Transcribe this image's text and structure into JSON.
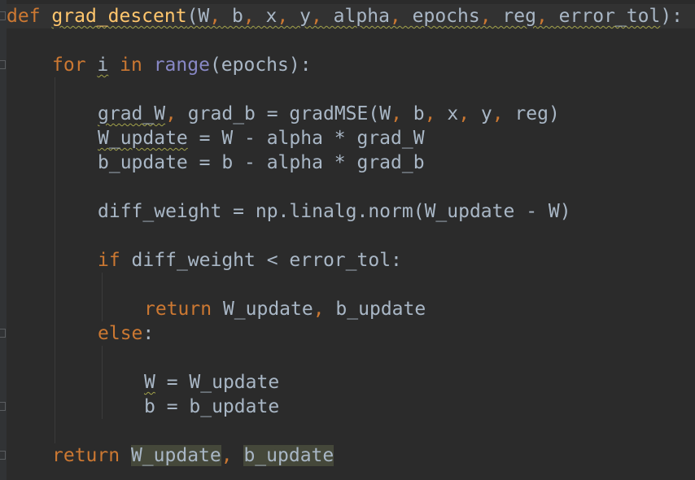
{
  "editor": {
    "lines": [
      {
        "indent": 0,
        "tokens": [
          {
            "t": "def",
            "c": "kw"
          },
          {
            "t": " "
          },
          {
            "t": "grad_descent",
            "c": "fn",
            "u": true
          },
          {
            "t": "(W",
            "u": true
          },
          {
            "t": ",",
            "c": "comma",
            "u": true
          },
          {
            "t": " b",
            "u": true
          },
          {
            "t": ",",
            "c": "comma",
            "u": true
          },
          {
            "t": " x",
            "u": true
          },
          {
            "t": ",",
            "c": "comma",
            "u": true
          },
          {
            "t": " y",
            "u": true
          },
          {
            "t": ",",
            "c": "comma",
            "u": true
          },
          {
            "t": " alpha",
            "u": true
          },
          {
            "t": ",",
            "c": "comma",
            "u": true
          },
          {
            "t": " epochs",
            "u": true
          },
          {
            "t": ",",
            "c": "comma",
            "u": true
          },
          {
            "t": " reg",
            "u": true
          },
          {
            "t": ",",
            "c": "comma",
            "u": true
          },
          {
            "t": " error_tol",
            "u": true
          },
          {
            "t": "):"
          }
        ]
      },
      {
        "indent": 0,
        "tokens": []
      },
      {
        "indent": 1,
        "tokens": [
          {
            "t": "for",
            "c": "kw"
          },
          {
            "t": " "
          },
          {
            "t": "i",
            "u": true
          },
          {
            "t": " "
          },
          {
            "t": "in",
            "c": "kw"
          },
          {
            "t": " "
          },
          {
            "t": "range",
            "c": "builtin"
          },
          {
            "t": "(epochs):"
          }
        ]
      },
      {
        "indent": 0,
        "tokens": []
      },
      {
        "indent": 2,
        "tokens": [
          {
            "t": "grad_W",
            "u": true
          },
          {
            "t": ",",
            "c": "comma"
          },
          {
            "t": " grad_b = gradMSE(W"
          },
          {
            "t": ",",
            "c": "comma"
          },
          {
            "t": " b"
          },
          {
            "t": ",",
            "c": "comma"
          },
          {
            "t": " x"
          },
          {
            "t": ",",
            "c": "comma"
          },
          {
            "t": " y"
          },
          {
            "t": ",",
            "c": "comma"
          },
          {
            "t": " reg)"
          }
        ]
      },
      {
        "indent": 2,
        "tokens": [
          {
            "t": "W_update",
            "u": true
          },
          {
            "t": " = W - alpha * grad_W"
          }
        ]
      },
      {
        "indent": 2,
        "tokens": [
          {
            "t": "b_update = b - alpha * grad_b"
          }
        ]
      },
      {
        "indent": 0,
        "tokens": []
      },
      {
        "indent": 2,
        "tokens": [
          {
            "t": "diff_weight = np.linalg.norm(W_update - W)"
          }
        ]
      },
      {
        "indent": 0,
        "tokens": []
      },
      {
        "indent": 2,
        "tokens": [
          {
            "t": "if",
            "c": "kw"
          },
          {
            "t": " diff_weight < error_tol:"
          }
        ]
      },
      {
        "indent": 0,
        "tokens": []
      },
      {
        "indent": 3,
        "tokens": [
          {
            "t": "return",
            "c": "kw"
          },
          {
            "t": " W_update"
          },
          {
            "t": ",",
            "c": "comma"
          },
          {
            "t": " b_update"
          }
        ]
      },
      {
        "indent": 2,
        "tokens": [
          {
            "t": "else",
            "c": "kw"
          },
          {
            "t": ":"
          }
        ]
      },
      {
        "indent": 0,
        "tokens": []
      },
      {
        "indent": 3,
        "tokens": [
          {
            "t": "W",
            "u": true
          },
          {
            "t": " = W_update"
          }
        ]
      },
      {
        "indent": 3,
        "tokens": [
          {
            "t": "b = b_update"
          }
        ]
      },
      {
        "indent": 0,
        "tokens": []
      },
      {
        "indent": 1,
        "tokens": [
          {
            "t": "return",
            "c": "kw"
          },
          {
            "t": " "
          },
          {
            "t": "W_update",
            "h": true
          },
          {
            "t": ",",
            "c": "comma"
          },
          {
            "t": " "
          },
          {
            "t": "b_update",
            "h": true
          }
        ]
      }
    ]
  }
}
